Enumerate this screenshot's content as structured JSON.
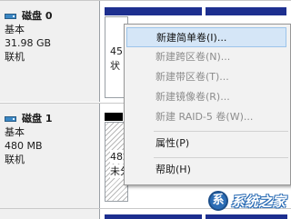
{
  "disks": [
    {
      "name": "磁盘 0",
      "type": "基本",
      "size": "31.98 GB",
      "status": "联机",
      "partition": {
        "line1": "45",
        "line2": "状"
      }
    },
    {
      "name": "磁盘 1",
      "type": "基本",
      "size": "480 MB",
      "status": "联机",
      "partition": {
        "line1": "48",
        "line2": "未分"
      }
    }
  ],
  "context_menu": {
    "items": [
      {
        "label": "新建简单卷(I)...",
        "enabled": true,
        "highlighted": true
      },
      {
        "label": "新建跨区卷(N)...",
        "enabled": false
      },
      {
        "label": "新建带区卷(T)...",
        "enabled": false
      },
      {
        "label": "新建镜像卷(R)...",
        "enabled": false
      },
      {
        "label": "新建 RAID-5 卷(W)...",
        "enabled": false
      },
      {
        "label": "属性(P)",
        "enabled": true
      },
      {
        "label": "帮助(H)",
        "enabled": true
      }
    ]
  },
  "watermark": {
    "text": "系统之家"
  },
  "colors": {
    "volume_bar_primary": "#1d2f8f",
    "volume_bar_unallocated": "#000000",
    "menu_highlight": "#d5e6f7",
    "disk_icon": "#3b87c4"
  }
}
